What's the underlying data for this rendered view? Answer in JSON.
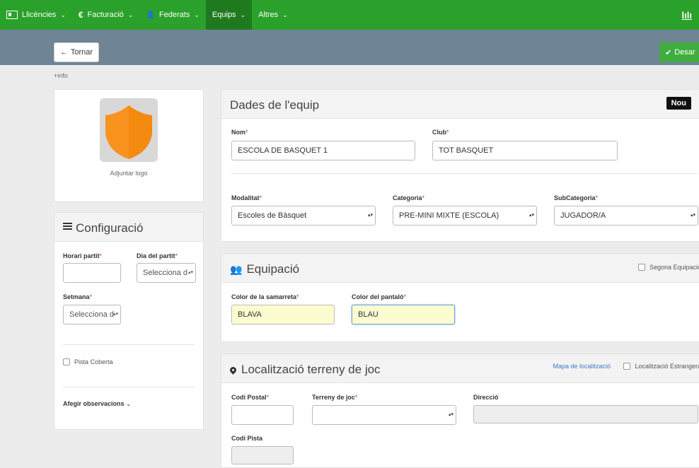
{
  "nav": {
    "items": [
      {
        "label": "Llicències",
        "icon": "id-card-icon"
      },
      {
        "label": "Facturació",
        "icon": "euro-icon",
        "glyph": "€"
      },
      {
        "label": "Federats",
        "icon": "user-icon",
        "glyph": "👤"
      },
      {
        "label": "Equips",
        "icon": "",
        "glyph": ""
      },
      {
        "label": "Altres",
        "icon": "",
        "glyph": ""
      }
    ],
    "caret": "⌄",
    "chart_glyph": "lılı"
  },
  "toolbar": {
    "back_label": "Tornar",
    "back_arrow": "←",
    "save_label": "Desar",
    "save_check": "✔"
  },
  "info_link": "+info",
  "logo": {
    "label": "Adjuntar logo",
    "shield_color": "#f7931e"
  },
  "config": {
    "title": "Configuració",
    "horari_label": "Horari partit",
    "dia_label": "Dia del partit",
    "dia_value": "Selecciona d",
    "setmana_label": "Setmana",
    "setmana_value": "Selecciona d",
    "pista_coberta": "Pista Coberta",
    "observacions": "Afegir observacions",
    "obs_caret": "⌄"
  },
  "team": {
    "title": "Dades de l'equip",
    "badge": "Nou",
    "nom_label": "Nom",
    "nom_value": "ESCOLA DE BASQUET 1",
    "club_label": "Club",
    "club_value": "TOT BASQUET",
    "modalitat_label": "Modalitat",
    "modalitat_value": "Escoles de Bàsquet",
    "categoria_label": "Categoria",
    "categoria_value": "PRE-MINI MIXTE (ESCOLA)",
    "subcategoria_label": "SubCategoria",
    "subcategoria_value": "JUGADOR/A"
  },
  "kit": {
    "title": "Equipació",
    "segona": "Segona Equipació",
    "samarreta_label": "Color de la samarreta",
    "samarreta_value": "BLAVA",
    "pantalo_label": "Color del pantaló",
    "pantalo_value": "BLAU"
  },
  "location": {
    "title": "Localització terreny de joc",
    "map_link": "Mapa de localització",
    "estrangera": "Localització Estrangera",
    "postal_label": "Codi Postal",
    "terreny_label": "Terreny de joc",
    "direccio_label": "Direcció",
    "pista_label": "Codi Pista"
  },
  "required_mark": "*",
  "colors": {
    "nav_green": "#2aa12a",
    "toolbar": "#6f8494",
    "save_green": "#3fae3f"
  }
}
